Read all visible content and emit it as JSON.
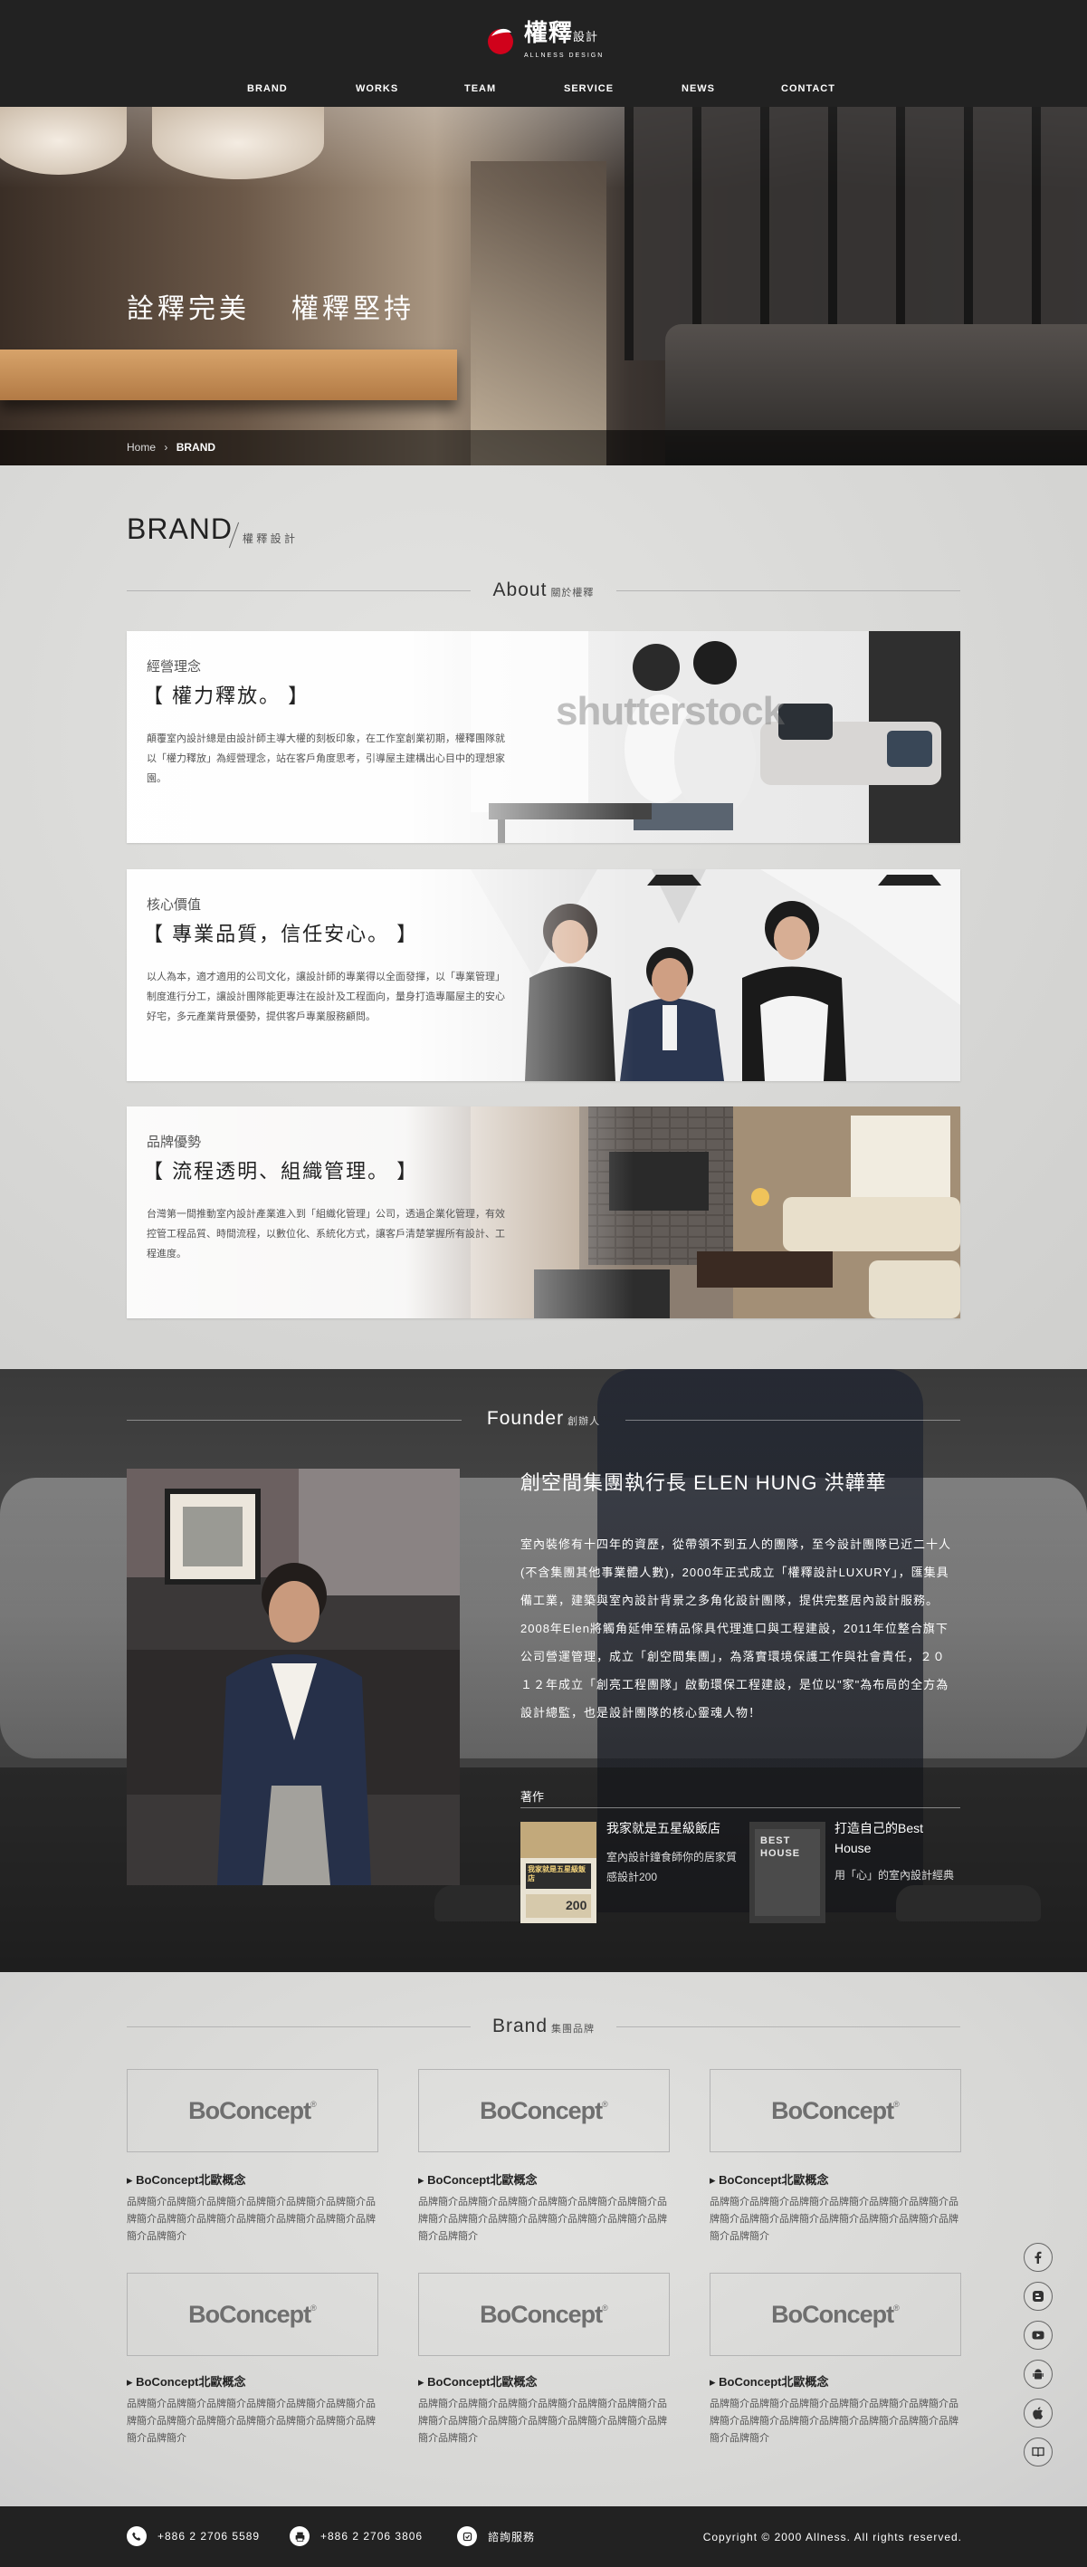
{
  "header": {
    "logo_zh": "權釋",
    "logo_zh_sub": "設計",
    "logo_en": "ALLNESS DESIGN",
    "nav": [
      "BRAND",
      "WORKS",
      "TEAM",
      "SERVICE",
      "NEWS",
      "CONTACT"
    ]
  },
  "hero": {
    "slogan_left": "詮釋完美",
    "slogan_right": "權釋堅持",
    "breadcrumb_home": "Home",
    "breadcrumb_sep": "›",
    "breadcrumb_current": "BRAND"
  },
  "brand_page": {
    "heading": "BRAND",
    "heading_sub": "權 釋 設 計",
    "about_title": "About",
    "about_sub": "關於權釋",
    "cards": [
      {
        "label": "經營理念",
        "title": "【 權力釋放。 】",
        "body": "顛覆室內設計總是由設計師主導大權的刻板印象，在工作室創業初期，權釋團隊就以「權力釋放」為經營理念，站在客戶角度思考，引導屋主建構出心目中的理想家園。",
        "watermark": "shutterstock"
      },
      {
        "label": "核心價值",
        "title": "【 專業品質，信任安心。 】",
        "body": "以人為本，適才適用的公司文化，讓設計師的專業得以全面發揮，以「專業管理」制度進行分工，讓設計團隊能更專注在設計及工程面向，量身打造專屬屋主的安心好宅，多元產業背景優勢，提供客戶專業服務顧問。"
      },
      {
        "label": "品牌優勢",
        "title": "【 流程透明、組織管理。 】",
        "body": "台灣第一間推動室內設計產業進入到「組織化管理」公司，透過企業化管理，有效控管工程品質、時間流程，以數位化、系統化方式，讓客戶清楚掌握所有設計、工程進度。"
      }
    ]
  },
  "founder": {
    "title": "Founder",
    "title_sub": "創辦人",
    "name": "創空間集團執行長 ELEN HUNG 洪韡華",
    "bio": [
      "室內裝修有十四年的資歷，從帶領不到五人的團隊，至今設計團隊已近二十人(不含集團其他事業體人數)，2000年正式成立「權釋設計LUXURY」，匯集具備工業，建築與室內設計背景之多角化設計團隊，提供完整居內設計服務。",
      "2008年Elen將觸角延伸至精品傢具代理進口與工程建設，2011年位整合旗下公司營運管理，成立「創空間集團」，為落實環境保護工作與社會責任，２０１２年成立「創亮工程團隊」啟動環保工程建設，是位以\"家\"為布局的全方為設計總監，也是設計團隊的核心靈魂人物！"
    ],
    "works_label": "著作",
    "books": [
      {
        "title": "我家就是五星級飯店",
        "desc": "室內設計鐘食師你的居家質感設計200",
        "cover_text": "我家就是五星級飯店",
        "cover_num": "200"
      },
      {
        "title": "打造自己的Best House",
        "desc": "用「心」的室內設計經典",
        "cover_text": "BEST HOUSE"
      }
    ]
  },
  "brands": {
    "title": "Brand",
    "title_sub": "集團品牌",
    "logo_word": "BoConcept",
    "items": [
      {
        "name": "BoConcept北歐概念",
        "desc": "品牌簡介品牌簡介品牌簡介品牌簡介品牌簡介品牌簡介品牌簡介品牌簡介品牌簡介品牌簡介品牌簡介品牌簡介品牌簡介品牌簡介"
      },
      {
        "name": "BoConcept北歐概念",
        "desc": "品牌簡介品牌簡介品牌簡介品牌簡介品牌簡介品牌簡介品牌簡介品牌簡介品牌簡介品牌簡介品牌簡介品牌簡介品牌簡介品牌簡介"
      },
      {
        "name": "BoConcept北歐概念",
        "desc": "品牌簡介品牌簡介品牌簡介品牌簡介品牌簡介品牌簡介品牌簡介品牌簡介品牌簡介品牌簡介品牌簡介品牌簡介品牌簡介品牌簡介"
      },
      {
        "name": "BoConcept北歐概念",
        "desc": "品牌簡介品牌簡介品牌簡介品牌簡介品牌簡介品牌簡介品牌簡介品牌簡介品牌簡介品牌簡介品牌簡介品牌簡介品牌簡介品牌簡介"
      },
      {
        "name": "BoConcept北歐概念",
        "desc": "品牌簡介品牌簡介品牌簡介品牌簡介品牌簡介品牌簡介品牌簡介品牌簡介品牌簡介品牌簡介品牌簡介品牌簡介品牌簡介品牌簡介"
      },
      {
        "name": "BoConcept北歐概念",
        "desc": "品牌簡介品牌簡介品牌簡介品牌簡介品牌簡介品牌簡介品牌簡介品牌簡介品牌簡介品牌簡介品牌簡介品牌簡介品牌簡介品牌簡介"
      }
    ]
  },
  "social_icons": [
    "facebook-icon",
    "blogger-icon",
    "youtube-icon",
    "android-icon",
    "apple-icon",
    "book-icon"
  ],
  "footer": {
    "phone": "+886 2 2706 5589",
    "fax": "+886 2 2706 3806",
    "service": "諮詢服務",
    "copyright": "Copyright © 2000 Allness. All rights reserved."
  },
  "colors": {
    "header_bg": "#222222",
    "accent_red": "#d0021b",
    "footer_bg": "#222222"
  }
}
